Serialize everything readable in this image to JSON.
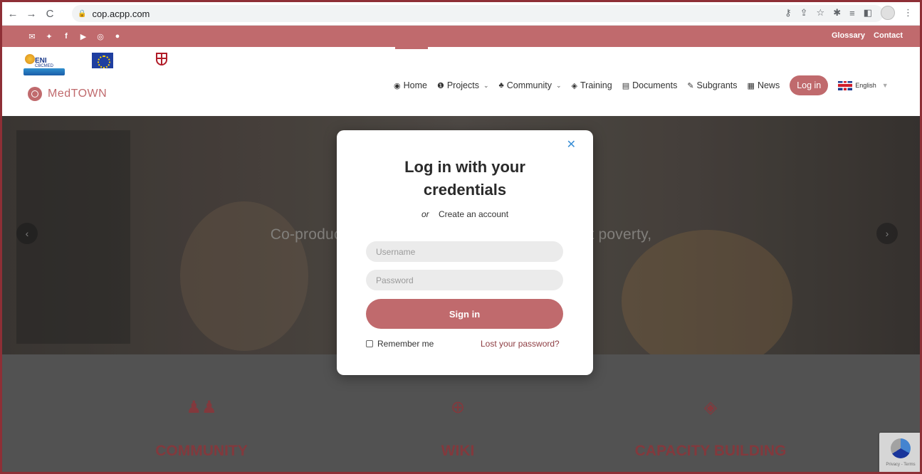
{
  "browser": {
    "url": "cop.acpp.com",
    "icons": [
      "back-icon",
      "forward-icon",
      "reload-icon",
      "lock-icon",
      "key-icon",
      "share-icon",
      "star-icon",
      "extensions-icon",
      "reading-list-icon",
      "side-panel-icon",
      "profile-icon",
      "menu-icon"
    ]
  },
  "topbar": {
    "social_icons": [
      "mail-icon",
      "twitter-icon",
      "facebook-icon",
      "youtube-icon",
      "instagram-icon",
      "web-icon"
    ],
    "links": [
      "Glossary",
      "Contact"
    ]
  },
  "header": {
    "brand": "MedTOWN",
    "logos": {
      "eni": "ENI",
      "eni_sub": "CBCMED"
    },
    "menu": [
      {
        "label": "Home",
        "icon": "home-icon"
      },
      {
        "label": "Projects",
        "icon": "info-icon",
        "dropdown": true
      },
      {
        "label": "Community",
        "icon": "community-icon",
        "dropdown": true
      },
      {
        "label": "Training",
        "icon": "graduation-cap-icon"
      },
      {
        "label": "Documents",
        "icon": "document-icon"
      },
      {
        "label": "Subgrants",
        "icon": "edit-icon"
      },
      {
        "label": "News",
        "icon": "newspaper-icon"
      }
    ],
    "login_label": "Log in",
    "language": "English"
  },
  "hero": {
    "text_left": "Co-producti",
    "text_right": "t poverty,"
  },
  "features": [
    {
      "title": "COMMUNITY",
      "icon": "users-icon"
    },
    {
      "title": "WIKI",
      "icon": "globe-network-icon"
    },
    {
      "title": "CAPACITY BUILDING",
      "icon": "graduation-cap-icon"
    }
  ],
  "modal": {
    "title_line1": "Log in with your",
    "title_line2": "credentials",
    "or": "or",
    "create_account": "Create an account",
    "username_placeholder": "Username",
    "password_placeholder": "Password",
    "sign_in": "Sign in",
    "remember_me": "Remember me",
    "lost_password": "Lost your password?"
  },
  "recaptcha": {
    "text": "Privacy - Terms"
  },
  "colors": {
    "brand": "#c06a6d",
    "brand_dark": "#8e3e43",
    "close": "#3a8fd6"
  }
}
